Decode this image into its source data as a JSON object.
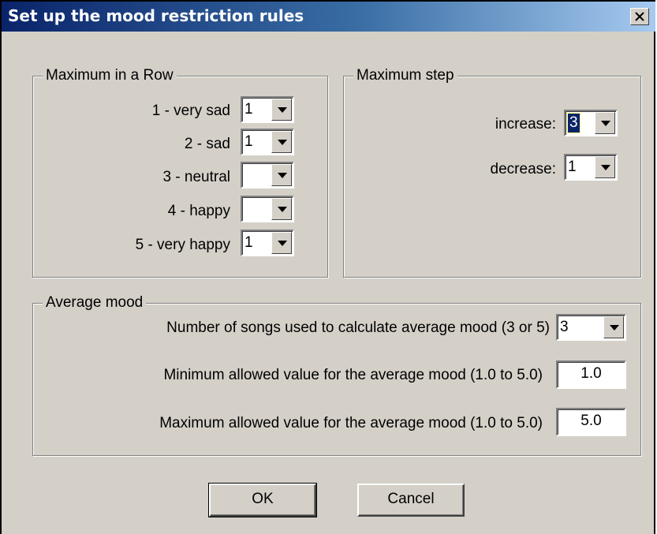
{
  "window": {
    "title": "Set up the mood restriction rules",
    "close_glyph": "close-icon"
  },
  "max_in_row": {
    "legend": "Maximum in a Row",
    "rows": [
      {
        "label": "1 - very sad",
        "value": "1"
      },
      {
        "label": "2 - sad",
        "value": "1"
      },
      {
        "label": "3 - neutral",
        "value": ""
      },
      {
        "label": "4 - happy",
        "value": ""
      },
      {
        "label": "5 - very happy",
        "value": "1"
      }
    ]
  },
  "max_step": {
    "legend": "Maximum step",
    "increase_label": "increase:",
    "increase_value": "3",
    "decrease_label": "decrease:",
    "decrease_value": "1"
  },
  "average_mood": {
    "legend": "Average mood",
    "songs_label": "Number of songs used to calculate average mood (3 or 5)",
    "songs_value": "3",
    "min_label": "Minimum allowed value for the average mood (1.0 to 5.0)",
    "min_value": "1.0",
    "max_label": "Maximum allowed value for the average mood (1.0 to 5.0)",
    "max_value": "5.0"
  },
  "buttons": {
    "ok": "OK",
    "cancel": "Cancel"
  },
  "colors": {
    "title_start": "#0a246a",
    "title_end": "#a6caf0",
    "dialog_bg": "#d4d0c8"
  }
}
